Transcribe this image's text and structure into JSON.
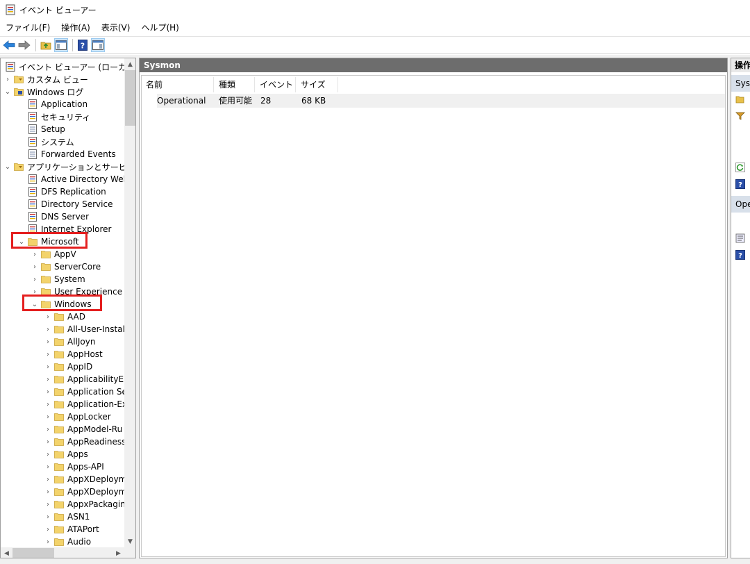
{
  "window": {
    "title": "イベント ビューアー"
  },
  "menu": [
    {
      "label": "ファイル(F)"
    },
    {
      "label": "操作(A)"
    },
    {
      "label": "表示(V)"
    },
    {
      "label": "ヘルプ(H)"
    }
  ],
  "tree": {
    "root": "イベント ビューアー (ローカル)",
    "custom_views": "カスタム ビュー",
    "windows_logs": "Windows ログ",
    "windows_log_items": [
      "Application",
      "セキュリティ",
      "Setup",
      "システム",
      "Forwarded Events"
    ],
    "app_services": "アプリケーションとサービス ログ",
    "app_service_items": [
      "Active Directory Web",
      "DFS Replication",
      "Directory Service",
      "DNS Server",
      "Internet Explorer"
    ],
    "microsoft": "Microsoft",
    "microsoft_items": [
      "AppV",
      "ServerCore",
      "System",
      "User Experience Vi"
    ],
    "windows": "Windows",
    "windows_items": [
      "AAD",
      "All-User-Instal",
      "AllJoyn",
      "AppHost",
      "AppID",
      "ApplicabilityEr",
      "Application Se",
      "Application-Ex",
      "AppLocker",
      "AppModel-Ru",
      "AppReadiness",
      "Apps",
      "Apps-API",
      "AppXDeploym",
      "AppXDeploym",
      "AppxPackagin",
      "ASN1",
      "ATAPort",
      "Audio"
    ]
  },
  "center": {
    "header": "Sysmon",
    "columns": [
      "名前",
      "種類",
      "イベント数",
      "サイズ"
    ],
    "rows": [
      {
        "name": "Operational",
        "type": "使用可能",
        "count": "28",
        "size": "68 KB"
      }
    ]
  },
  "actions": {
    "header": "操作",
    "section1": "Sysmon",
    "section2": "Operational"
  },
  "colors": {
    "highlight": "#e41f1f",
    "center_header_bg": "#6d6d6d",
    "selection_bg": "#d8e0ea"
  }
}
